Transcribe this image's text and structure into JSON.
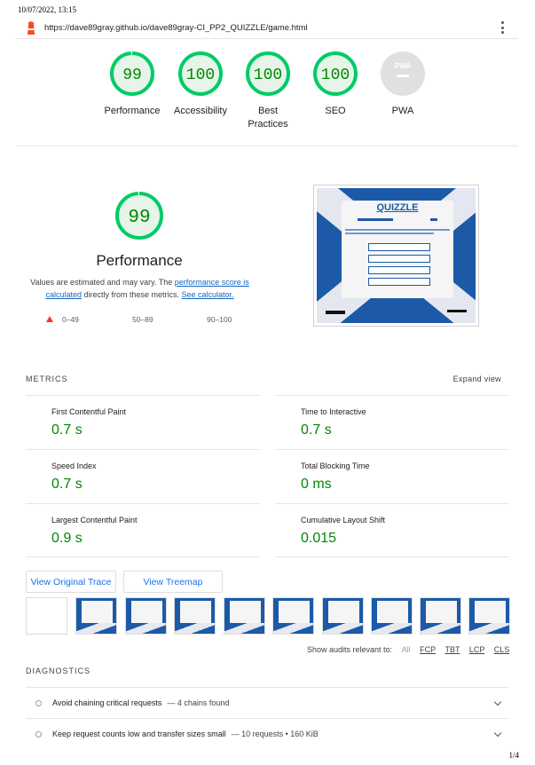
{
  "print": {
    "date": "10/07/2022, 13:15",
    "page": "1/4"
  },
  "url": "https://dave89gray.github.io/dave89gray-CI_PP2_QUIZZLE/game.html",
  "gauges": [
    {
      "score": "99",
      "label": "Performance",
      "fraction": 0.99
    },
    {
      "score": "100",
      "label": "Accessibility",
      "fraction": 1.0
    },
    {
      "score": "100",
      "label": "Best Practices",
      "fraction": 1.0
    },
    {
      "score": "100",
      "label": "SEO",
      "fraction": 1.0
    },
    {
      "score": "",
      "label": "PWA",
      "badge": "PWA"
    }
  ],
  "performance": {
    "score": "99",
    "fraction": 0.99,
    "title": "Performance",
    "desc_prefix": "Values are estimated and may vary. The ",
    "desc_link1": "performance score is calculated",
    "desc_mid": " directly from these metrics. ",
    "desc_link2": "See calculator.",
    "legend": {
      "fail": "0–49",
      "average": "50–89",
      "pass": "90–100"
    },
    "screenshot_title": "QUIZZLE"
  },
  "metrics": {
    "heading": "METRICS",
    "expand": "Expand view",
    "items": [
      {
        "label": "First Contentful Paint",
        "value": "0.7 s"
      },
      {
        "label": "Time to Interactive",
        "value": "0.7 s"
      },
      {
        "label": "Speed Index",
        "value": "0.7 s"
      },
      {
        "label": "Total Blocking Time",
        "value": "0 ms"
      },
      {
        "label": "Largest Contentful Paint",
        "value": "0.9 s"
      },
      {
        "label": "Cumulative Layout Shift",
        "value": "0.015"
      }
    ]
  },
  "buttons": {
    "trace": "View Original Trace",
    "treemap": "View Treemap"
  },
  "filters": {
    "prefix": "Show audits relevant to:",
    "all": "All",
    "fcp": "FCP",
    "tbt": "TBT",
    "lcp": "LCP",
    "cls": "CLS"
  },
  "diagnostics": {
    "heading": "DIAGNOSTICS",
    "items": [
      {
        "title": "Avoid chaining critical requests",
        "detail": "— 4 chains found"
      },
      {
        "title": "Keep request counts low and transfer sizes small",
        "detail": "— 10 requests • 160 KiB"
      }
    ]
  },
  "colors": {
    "pass": "#008800",
    "pass_bg": "#e6f4ea",
    "pass_ring": "#00cc66",
    "link": "#1a73e8",
    "quizzle_blue": "#1c5aa8"
  }
}
